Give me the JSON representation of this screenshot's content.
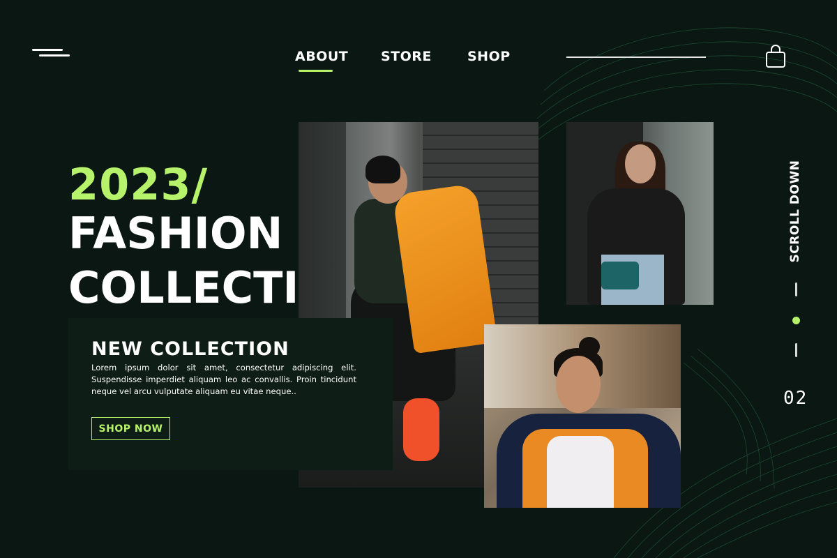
{
  "nav": {
    "items": [
      {
        "label": "ABOUT",
        "active": true
      },
      {
        "label": "STORE",
        "active": false
      },
      {
        "label": "SHOP",
        "active": false
      }
    ]
  },
  "hero": {
    "year": "2023/",
    "line1": "FASHION",
    "line2": "COLLECTION"
  },
  "collection": {
    "title": "NEW COLLECTION",
    "body": "Lorem ipsum dolor sit amet, consectetur adipiscing elit. Suspendisse imperdiet aliquam leo ac convallis. Proin tincidunt neque vel arcu vulputate aliquam eu vitae neque..",
    "button": "SHOP NOW"
  },
  "rail": {
    "scroll_label": "SCROLL DOWN",
    "page_number": "02"
  },
  "icons": {
    "menu": "menu-icon",
    "cart": "shopping-bag-icon"
  },
  "colors": {
    "background": "#0b1713",
    "accent": "#b6f36b",
    "card": "#0f1d17"
  }
}
